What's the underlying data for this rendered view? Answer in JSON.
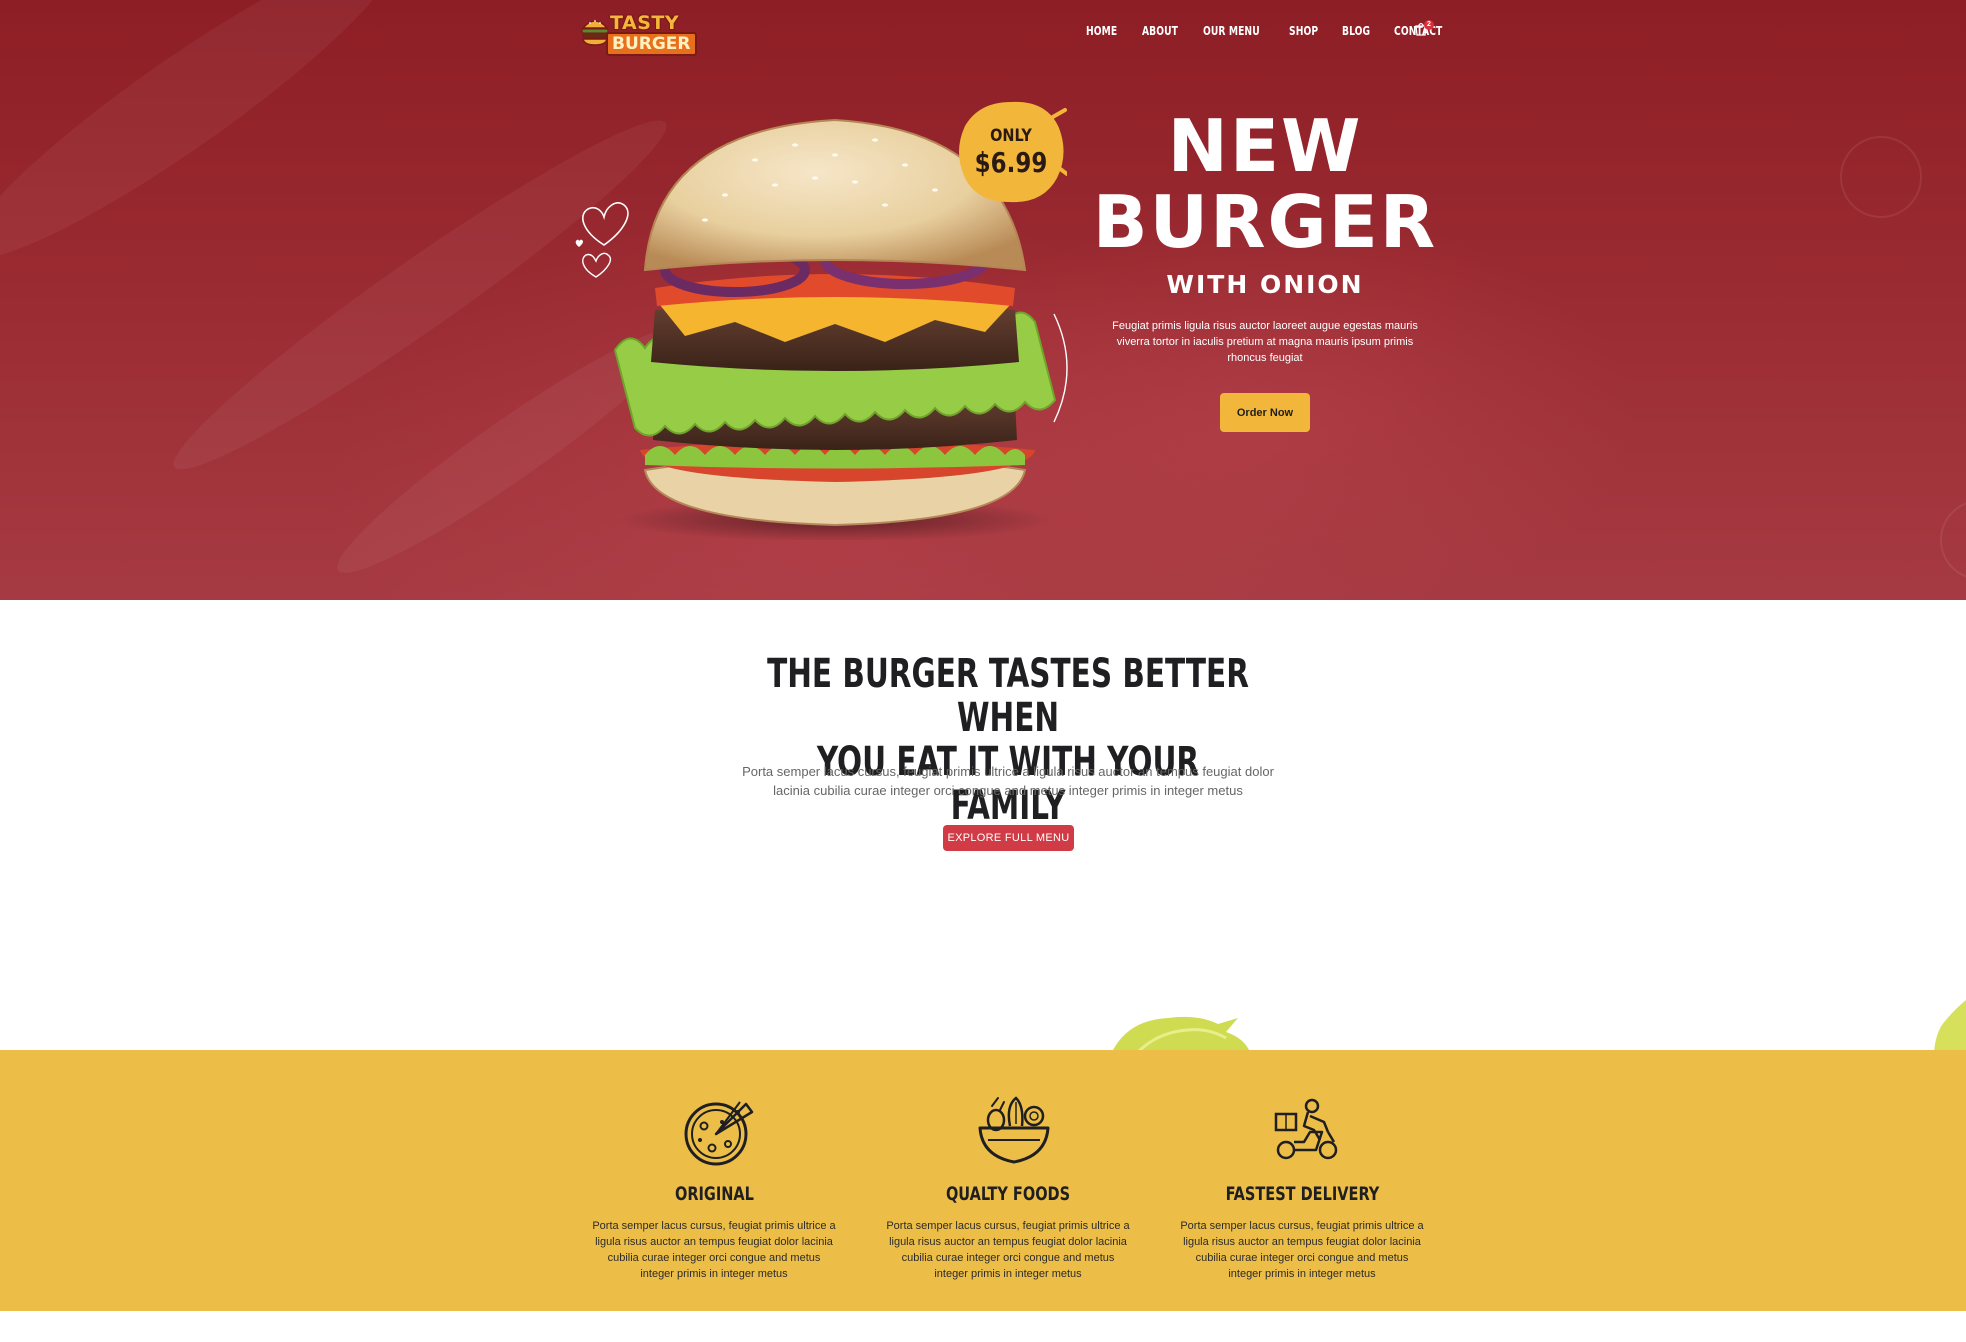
{
  "brand": {
    "logo_line1": "TASTY",
    "logo_line2": "BURGER"
  },
  "nav": {
    "items": [
      "HOME",
      "ABOUT",
      "OUR MENU",
      "SHOP",
      "BLOG",
      "CONTACT"
    ],
    "cart_icon": "shopping-bag-icon",
    "cart_count": "2"
  },
  "hero": {
    "badge_only": "ONLY",
    "badge_price": "$6.99",
    "title_line1": "NEW",
    "title_line2": "BURGER",
    "subtitle": "WITH ONION",
    "description": "Feugiat primis ligula risus auctor laoreet augue egestas mauris viverra tortor in iaculis pretium at magna mauris ipsum primis rhoncus feugiat",
    "cta_label": "Order Now"
  },
  "intro": {
    "title_line1": "THE BURGER TASTES BETTER WHEN",
    "title_line2": "YOU EAT IT WITH YOUR FAMILY",
    "description": "Porta semper lacus cursus, feugiat primis ultrice a ligula risus auctor an tempus feugiat dolor lacinia cubilia curae integer orci congue and metus integer primis in integer metus",
    "cta_label": "EXPLORE FULL MENU"
  },
  "features": [
    {
      "icon": "pizza-icon",
      "title": "ORIGINAL",
      "description": "Porta semper lacus cursus, feugiat primis ultrice a ligula risus auctor an tempus feugiat dolor lacinia cubilia curae integer orci congue and metus integer primis in integer metus"
    },
    {
      "icon": "salad-bowl-icon",
      "title": "QUALTY FOODS",
      "description": "Porta semper lacus cursus, feugiat primis ultrice a ligula risus auctor an tempus feugiat dolor lacinia cubilia curae integer orci congue and metus integer primis in integer metus"
    },
    {
      "icon": "delivery-scooter-icon",
      "title": "FASTEST DELIVERY",
      "description": "Porta semper lacus cursus, feugiat primis ultrice a ligula risus auctor an tempus feugiat dolor lacinia cubilia curae integer orci congue and metus integer primis in integer metus"
    }
  ],
  "colors": {
    "hero_red": "#9a2a31",
    "accent_yellow": "#edbe47",
    "button_yellow": "#f2b73a",
    "button_red": "#d03b45",
    "heading_dark": "#1f1f22"
  }
}
